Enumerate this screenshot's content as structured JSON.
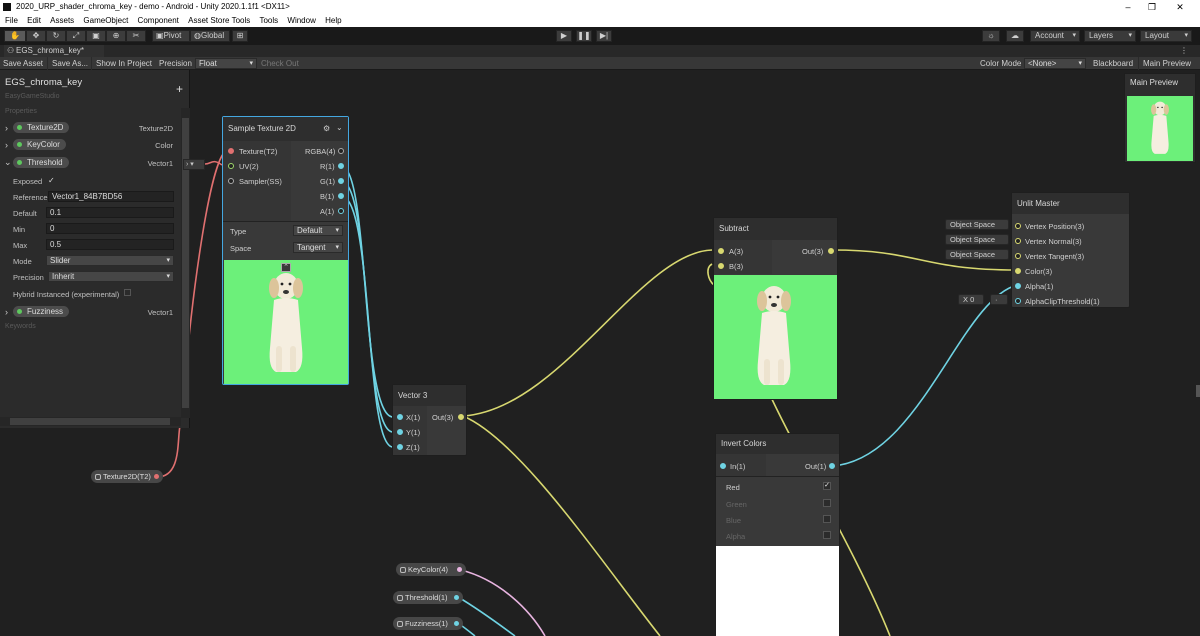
{
  "window": {
    "title": "2020_URP_shader_chroma_key - demo - Android - Unity 2020.1.1f1 <DX11>",
    "min": "–",
    "max": "❐",
    "close": "✕"
  },
  "menu": [
    "File",
    "Edit",
    "Assets",
    "GameObject",
    "Component",
    "Asset Store Tools",
    "Tools",
    "Window",
    "Help"
  ],
  "toolbar": {
    "pivot": "Pivot",
    "global": "Global",
    "account": "Account",
    "layers": "Layers",
    "layout": "Layout"
  },
  "tab": {
    "label": "EGS_chroma_key*"
  },
  "graph_toolbar": {
    "save_asset": "Save Asset",
    "save_as": "Save As...",
    "show_in_project": "Show In Project",
    "precision_label": "Precision",
    "precision_value": "Float",
    "check_out": "Check Out",
    "color_mode_label": "Color Mode",
    "color_mode_value": "<None>",
    "blackboard": "Blackboard",
    "main_preview": "Main Preview"
  },
  "blackboard": {
    "title": "EGS_chroma_key",
    "subtitle": "EasyGameStudio",
    "properties_label": "Properties",
    "keywords_label": "Keywords",
    "add": "+",
    "props": [
      {
        "name": "Texture2D",
        "type": "Texture2D"
      },
      {
        "name": "KeyColor",
        "type": "Color"
      },
      {
        "name": "Threshold",
        "type": "Vector1"
      },
      {
        "name": "Fuzziness",
        "type": "Vector1"
      }
    ],
    "threshold": {
      "exposed_label": "Exposed",
      "exposed": "✓",
      "reference_label": "Reference",
      "reference": "Vector1_84B7BD56",
      "default_label": "Default",
      "default": "0.1",
      "min_label": "Min",
      "min": "0",
      "max_label": "Max",
      "max": "0.5",
      "mode_label": "Mode",
      "mode": "Slider",
      "precision_label": "Precision",
      "precision": "Inherit",
      "hybrid_label": "Hybrid Instanced (experimental)"
    }
  },
  "main_preview": {
    "title": "Main Preview"
  },
  "nodes": {
    "sample": {
      "title": "Sample Texture 2D",
      "inputs": [
        "Texture(T2)",
        "UV(2)",
        "Sampler(SS)"
      ],
      "outputs": [
        "RGBA(4)",
        "R(1)",
        "G(1)",
        "B(1)",
        "A(1)"
      ],
      "type_label": "Type",
      "type_value": "Default",
      "space_label": "Space",
      "space_value": "Tangent"
    },
    "vector3": {
      "title": "Vector 3",
      "inputs": [
        "X(1)",
        "Y(1)",
        "Z(1)"
      ],
      "output": "Out(3)"
    },
    "subtract": {
      "title": "Subtract",
      "inputs": [
        "A(3)",
        "B(3)"
      ],
      "output": "Out(3)"
    },
    "invert": {
      "title": "Invert Colors",
      "input": "In(1)",
      "output": "Out(1)",
      "channels": [
        {
          "label": "Red",
          "checked": "✓"
        },
        {
          "label": "Green",
          "checked": ""
        },
        {
          "label": "Blue",
          "checked": ""
        },
        {
          "label": "Alpha",
          "checked": ""
        }
      ]
    },
    "master": {
      "title": "Unlit Master",
      "ports": [
        "Vertex Position(3)",
        "Vertex Normal(3)",
        "Vertex Tangent(3)",
        "Color(3)",
        "Alpha(1)",
        "AlphaClipThreshold(1)"
      ],
      "chips": [
        "Object Space",
        "Object Space",
        "Object Space"
      ],
      "alpha_clip_x": "X",
      "alpha_clip_value": "0"
    }
  },
  "property_nodes": [
    "Texture2D(T2)",
    "KeyColor(4)",
    "Threshold(1)",
    "Fuzziness(1)"
  ],
  "colors": {
    "edge_yellow": "#d8d870",
    "edge_cyan": "#6fd3e3",
    "edge_red": "#e07070",
    "edge_pink": "#e8b4e0",
    "green_bg": "#6cf07a",
    "selection": "#44a7e0"
  }
}
